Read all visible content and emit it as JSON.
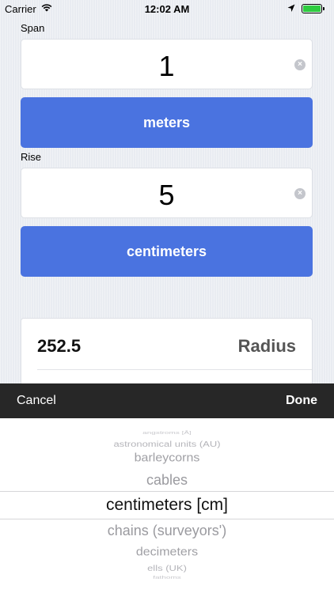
{
  "status_bar": {
    "carrier": "Carrier",
    "time": "12:02 AM",
    "wifi_icon": "wifi-icon",
    "location_icon": "location-arrow-icon",
    "battery_icon": "battery-full-icon",
    "battery_color": "#2ecc40"
  },
  "span": {
    "label": "Span",
    "value": "1",
    "unit": "meters",
    "clear_icon": "clear-circle-icon"
  },
  "rise": {
    "label": "Rise",
    "value": "5",
    "unit": "centimeters",
    "clear_icon": "clear-circle-icon"
  },
  "result": {
    "value": "252.5",
    "label": "Radius"
  },
  "toolbar": {
    "cancel": "Cancel",
    "done": "Done"
  },
  "picker": {
    "items": [
      "angstroms [Å]",
      "astronomical units (AU)",
      "barleycorns",
      "cables",
      "centimeters [cm]",
      "chains (surveyors')",
      "decimeters",
      "ells (UK)",
      "fathoms"
    ],
    "selected_index": 4
  },
  "colors": {
    "accent": "#4a73e0",
    "toolbar_bg": "#272727",
    "background": "#e9ecf1"
  }
}
